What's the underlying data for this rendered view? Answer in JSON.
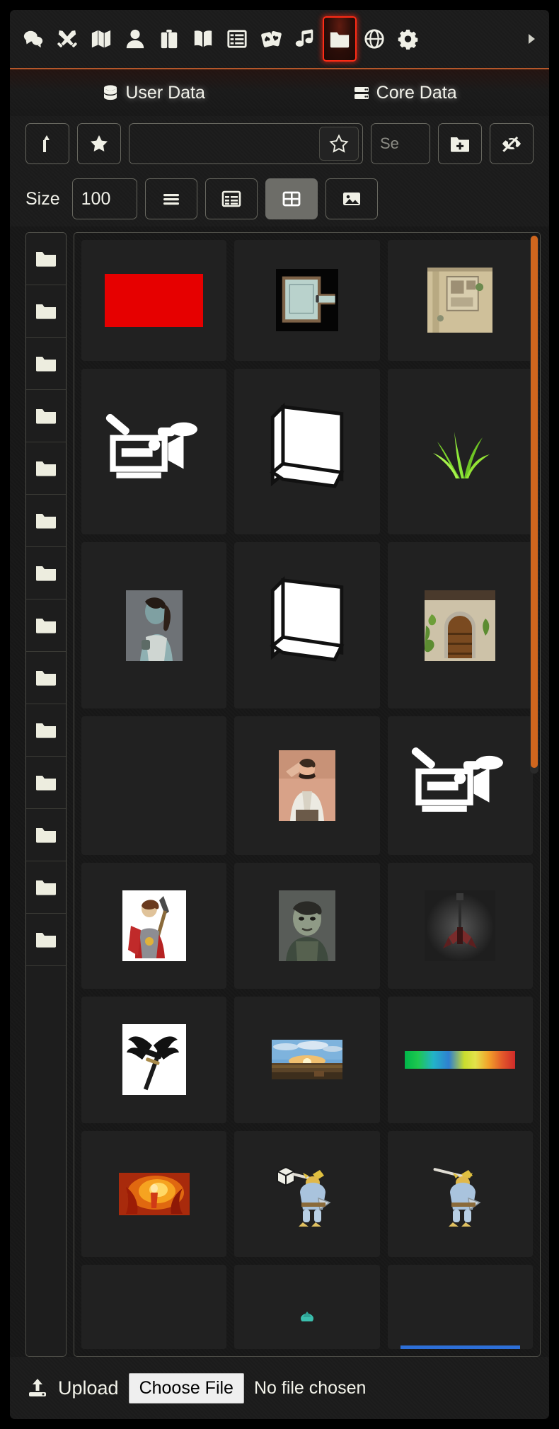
{
  "module_bar": {
    "items": [
      {
        "name": "chat-icon",
        "label": "Chat Log"
      },
      {
        "name": "combat-icon",
        "label": "Combat Encounters"
      },
      {
        "name": "scenes-icon",
        "label": "Scenes"
      },
      {
        "name": "actors-icon",
        "label": "Actors"
      },
      {
        "name": "items-icon",
        "label": "Items"
      },
      {
        "name": "journal-icon",
        "label": "Journal"
      },
      {
        "name": "tables-icon",
        "label": "Rollable Tables"
      },
      {
        "name": "cards-icon",
        "label": "Card Stacks"
      },
      {
        "name": "playlists-icon",
        "label": "Playlists"
      },
      {
        "name": "folder-icon",
        "label": "Compendium Packs",
        "active": true
      },
      {
        "name": "globe-icon",
        "label": "Game Settings"
      },
      {
        "name": "gears-icon",
        "label": "Configure Settings"
      }
    ],
    "more_label": "More",
    "active_accent": "#ff2b15"
  },
  "source_tabs": [
    {
      "name": "tab-user-data",
      "label": "User Data",
      "icon": "database-icon",
      "active": true
    },
    {
      "name": "tab-core-data",
      "label": "Core Data",
      "icon": "server-icon",
      "active": false
    }
  ],
  "toolbar": {
    "up_label": "Parent Directory",
    "favorites_label": "Favorites",
    "add_favorite_label": "Add Favorite",
    "search": {
      "value": "",
      "placeholder": "Se"
    },
    "new_folder_label": "New Folder",
    "toggle_privacy_label": "Toggle Privacy"
  },
  "size_row": {
    "size_label": "Size",
    "size_value": "100",
    "views": [
      {
        "name": "view-list",
        "icon": "list-icon",
        "selected": false
      },
      {
        "name": "view-details",
        "icon": "table-icon",
        "selected": false
      },
      {
        "name": "view-tiles",
        "icon": "grid-icon",
        "selected": true
      },
      {
        "name": "view-images",
        "icon": "image-icon",
        "selected": false
      }
    ]
  },
  "directories": {
    "count": 14,
    "item_icon": "folder-icon"
  },
  "files": {
    "scrollbar": {
      "color": "#d0661e",
      "position": "top"
    },
    "tiles": [
      {
        "name": "tile-red-swatch",
        "kind": "swatch",
        "color": "#e60000"
      },
      {
        "name": "tile-dungeon-map",
        "kind": "dungeon-map"
      },
      {
        "name": "tile-town-map",
        "kind": "town-map"
      },
      {
        "name": "tile-video-placeholder-1",
        "kind": "video-icon"
      },
      {
        "name": "tile-book-placeholder-1",
        "kind": "book-icon"
      },
      {
        "name": "tile-grass-tuft",
        "kind": "grass"
      },
      {
        "name": "tile-half-orc-portrait",
        "kind": "portrait-orc"
      },
      {
        "name": "tile-book-placeholder-2",
        "kind": "book-icon"
      },
      {
        "name": "tile-stone-door",
        "kind": "door"
      },
      {
        "name": "tile-empty",
        "kind": "empty"
      },
      {
        "name": "tile-human-portrait",
        "kind": "portrait-human"
      },
      {
        "name": "tile-video-placeholder-2",
        "kind": "video-icon"
      },
      {
        "name": "tile-knight-token",
        "kind": "knight"
      },
      {
        "name": "tile-orc-face-portrait",
        "kind": "portrait-orc-face"
      },
      {
        "name": "tile-guitar",
        "kind": "guitar"
      },
      {
        "name": "tile-black-axe",
        "kind": "axe"
      },
      {
        "name": "tile-sunset-panorama",
        "kind": "sunset"
      },
      {
        "name": "tile-color-gradient",
        "kind": "gradient"
      },
      {
        "name": "tile-fire-mage",
        "kind": "fire-mage"
      },
      {
        "name": "tile-kobold-token-1",
        "kind": "kobold-box"
      },
      {
        "name": "tile-kobold-token-2",
        "kind": "kobold"
      },
      {
        "name": "tile-row-partial-1",
        "kind": "empty"
      },
      {
        "name": "tile-row-partial-2",
        "kind": "empty"
      },
      {
        "name": "tile-row-partial-3",
        "kind": "empty"
      }
    ]
  },
  "upload": {
    "icon": "upload-icon",
    "label": "Upload",
    "choose_file_label": "Choose File",
    "file_status": "No file chosen"
  }
}
